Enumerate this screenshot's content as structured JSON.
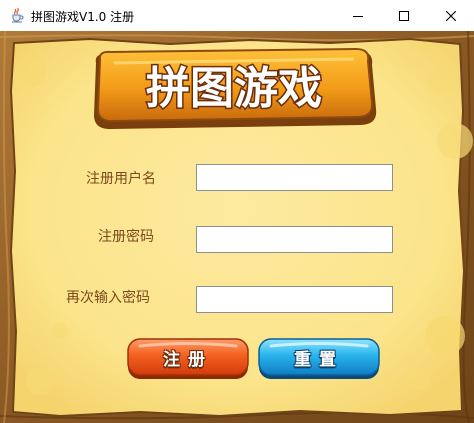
{
  "window": {
    "title": "拼图游戏V1.0 注册",
    "app_icon": "java-cup-icon",
    "controls": [
      "minimize-icon",
      "maximize-icon",
      "close-icon"
    ]
  },
  "logo": {
    "text": "拼图游戏"
  },
  "form": {
    "username_label": "注册用户名",
    "username_value": "",
    "password_label": "注册密码",
    "password_value": "",
    "confirm_label": "再次输入密码",
    "confirm_value": ""
  },
  "buttons": {
    "register_label": "注册",
    "reset_label": "重置"
  },
  "colors": {
    "parchment": "#fbe58d",
    "wood_frame": "#8a5a24",
    "label_text": "#7b4a1c",
    "register_button": "#f25a1c",
    "reset_button": "#1aa8e6"
  }
}
